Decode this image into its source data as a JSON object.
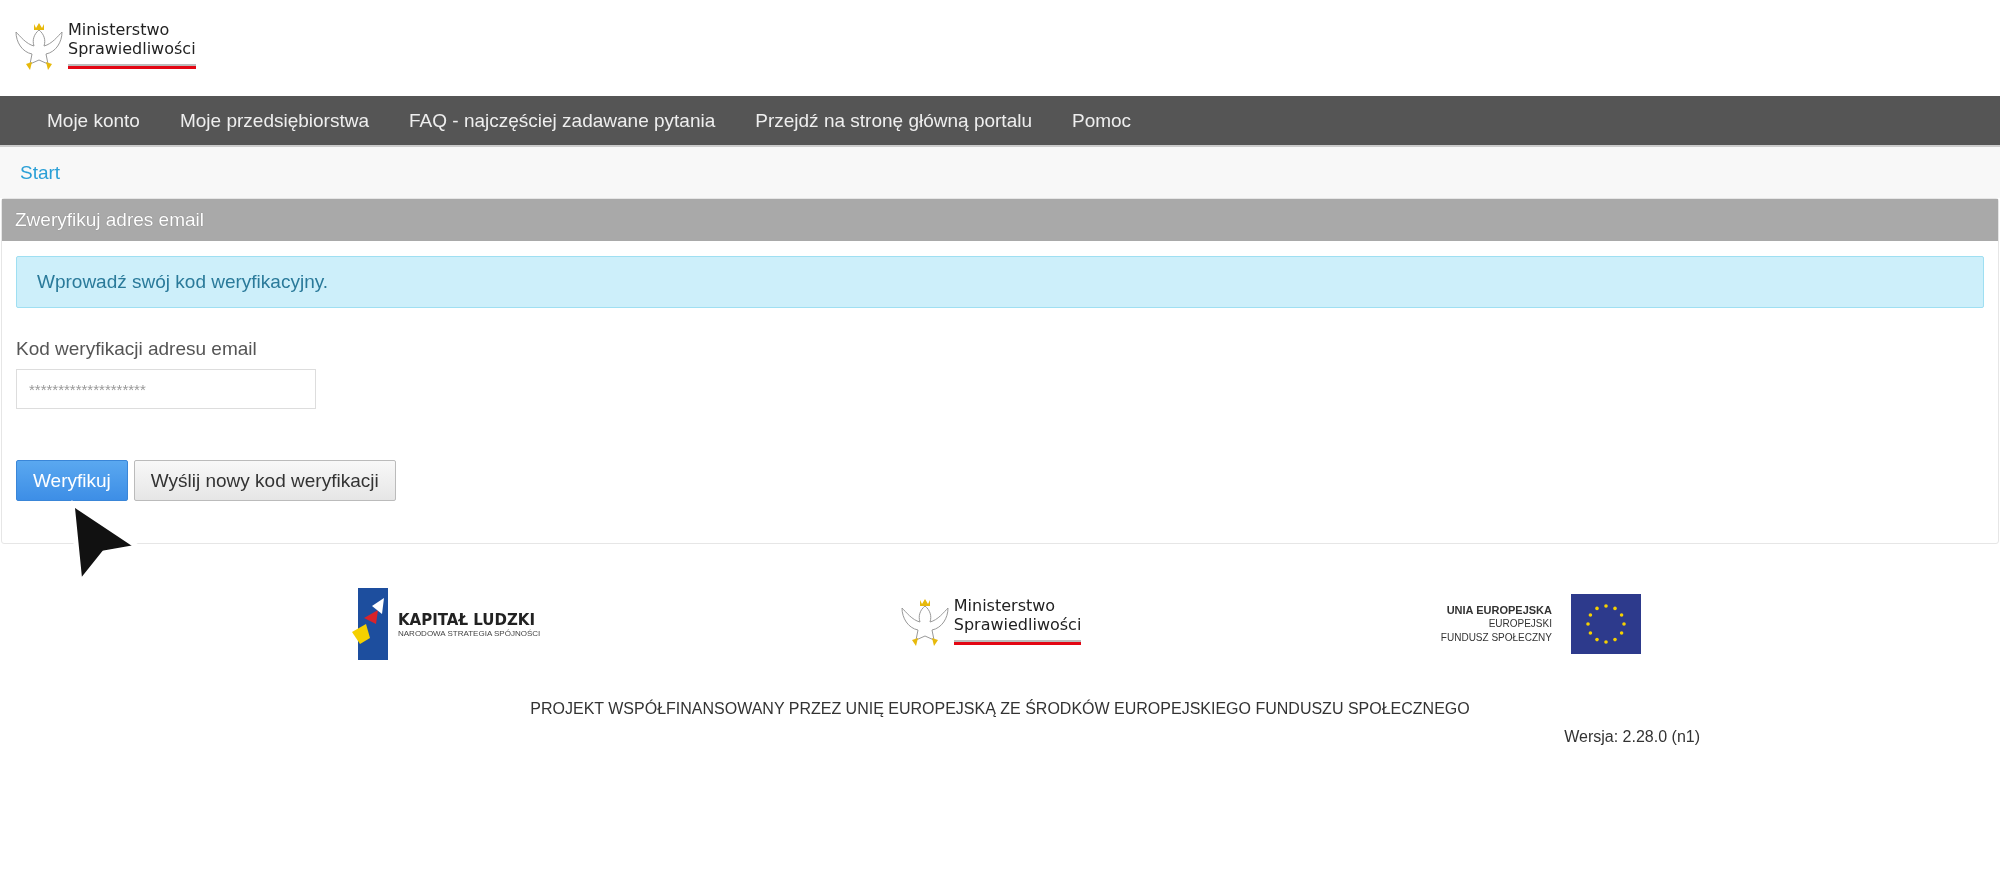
{
  "header": {
    "logo": {
      "line1": "Ministerstwo",
      "line2": "Sprawiedliwości"
    }
  },
  "nav": {
    "items": [
      {
        "label": "Moje konto"
      },
      {
        "label": "Moje przedsiębiorstwa"
      },
      {
        "label": "FAQ - najczęściej zadawane pytania"
      },
      {
        "label": "Przejdź na stronę główną portalu"
      },
      {
        "label": "Pomoc"
      }
    ]
  },
  "breadcrumb": {
    "label": "Start"
  },
  "panel": {
    "title": "Zweryfikuj adres email",
    "alert": "Wprowadź swój kod weryfikacyjny.",
    "field": {
      "label": "Kod weryfikacji adresu email",
      "placeholder": "********************"
    },
    "buttons": [
      {
        "label": "Weryfikuj",
        "kind": "primary"
      },
      {
        "label": "Wyślij nowy kod weryfikacji",
        "kind": "default"
      }
    ]
  },
  "footer": {
    "kapital": {
      "title": "KAPITAŁ LUDZKI",
      "subtitle": "NARODOWA STRATEGIA SPÓJNOŚCI"
    },
    "ministry": {
      "line1": "Ministerstwo",
      "line2": "Sprawiedliwości"
    },
    "eu": {
      "line1": "UNIA EUROPEJSKA",
      "line2": "EUROPEJSKI",
      "line3": "FUNDUSZ SPOŁECZNY"
    },
    "project": "PROJEKT WSPÓŁFINANSOWANY PRZEZ UNIĘ EUROPEJSKĄ ZE ŚRODKÓW EUROPEJSKIEGO FUNDUSZU SPOŁECZNEGO",
    "version": "Wersja: 2.28.0 (n1)"
  }
}
